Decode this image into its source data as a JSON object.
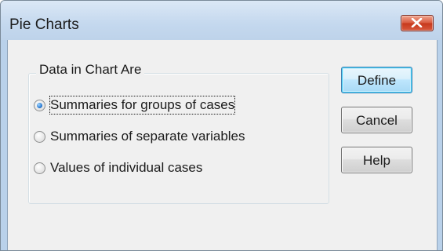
{
  "dialog": {
    "title": "Pie Charts",
    "close_icon": "close-x-icon"
  },
  "group": {
    "label": "Data in Chart Are",
    "options": [
      {
        "label": "Summaries for groups of cases",
        "checked": true
      },
      {
        "label": "Summaries of separate variables",
        "checked": false
      },
      {
        "label": "Values of individual cases",
        "checked": false
      }
    ]
  },
  "buttons": {
    "define": "Define",
    "cancel": "Cancel",
    "help": "Help"
  },
  "colors": {
    "close_button": "#c6381b",
    "radio_selected": "#2a7bd3",
    "default_button_border": "#3c7fb1"
  }
}
